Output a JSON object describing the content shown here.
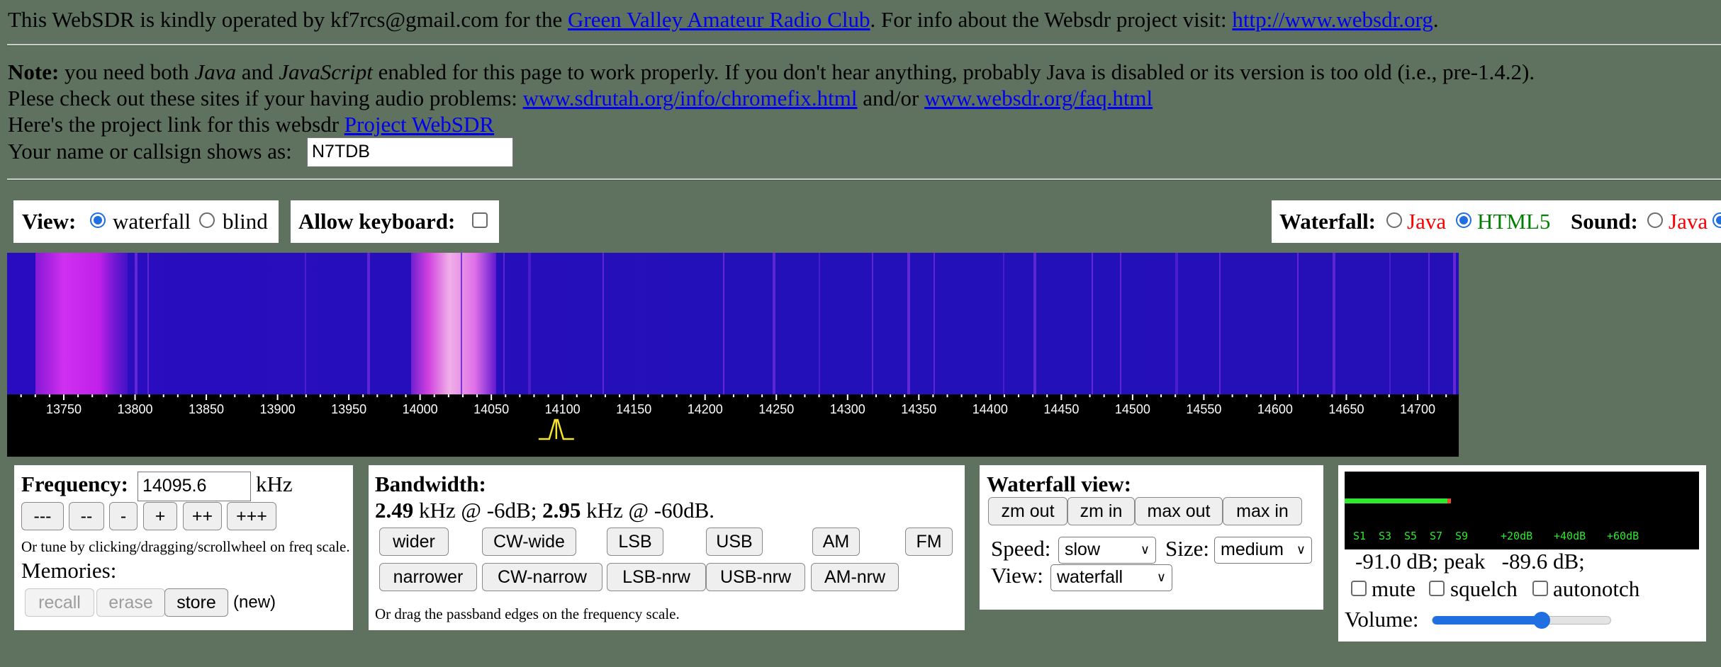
{
  "header": {
    "intro_pre": "This WebSDR is kindly operated by kf7rcs@gmail.com for the ",
    "club_link": "Green Valley Amateur Radio Club",
    "intro_mid": ". For info about the Websdr project visit: ",
    "websdr_link": "http://www.websdr.org",
    "intro_end": "."
  },
  "note": {
    "label": "Note:",
    "t1": " you need both ",
    "java": "Java",
    "t2": " and ",
    "javascript": "JavaScript",
    "t3": " enabled for this page to work properly. If you don't hear anything, probably Java is disabled or its version is too old (i.e., pre-1.4.2).",
    "check_pre": "Plese check out these sites if your having audio problems: ",
    "chromefix_link": "www.sdrutah.org/info/chromefix.html",
    "check_mid": " and/or ",
    "faq_link": "www.websdr.org/faq.html",
    "project_pre": "Here's the project link for this websdr ",
    "project_link": "Project WebSDR",
    "callsign_label": "Your name or callsign shows as:",
    "callsign_value": "N7TDB"
  },
  "view_box": {
    "label": "View:",
    "opt1": "waterfall",
    "opt2": "blind",
    "selected": "waterfall"
  },
  "keyboard_box": {
    "label": "Allow keyboard:",
    "checked": false
  },
  "engine_box": {
    "waterfall_label": "Waterfall:",
    "java": "Java",
    "html5": "HTML5",
    "sound_label": "Sound:",
    "sound_java": "Java",
    "java_color": "#ff0000",
    "html5_color": "#008000"
  },
  "scale": {
    "ticks": [
      "13750",
      "13800",
      "13850",
      "13900",
      "13950",
      "14000",
      "14050",
      "14100",
      "14150",
      "14200",
      "14250",
      "14300",
      "14350",
      "14400",
      "14450",
      "14500",
      "14550",
      "14600",
      "14650",
      "14700"
    ],
    "tuned_khz": 14095.6
  },
  "frequency_box": {
    "label": "Frequency:",
    "value": "14095.6",
    "unit": "kHz",
    "steps": [
      "---",
      "--",
      "-",
      "+",
      "++",
      "+++"
    ],
    "hint": "Or tune by clicking/dragging/scrollwheel on freq scale.",
    "memories_label": "Memories:",
    "recall": "recall",
    "erase": "erase",
    "store": "store",
    "new_label": "(new)"
  },
  "bandwidth_box": {
    "label": "Bandwidth:",
    "bw1": "2.49",
    "bw1_text": " kHz @ -6dB; ",
    "bw2": "2.95",
    "bw2_text": " kHz @ -60dB.",
    "row1": [
      "wider",
      "CW-wide",
      "LSB",
      "USB",
      "AM",
      "FM"
    ],
    "row2": [
      "narrower",
      "CW-narrow",
      "LSB-nrw",
      "USB-nrw",
      "AM-nrw"
    ],
    "hint": "Or drag the passband edges on the frequency scale."
  },
  "waterfall_view_box": {
    "label": "Waterfall view:",
    "buttons": [
      "zm out",
      "zm in",
      "max out",
      "max in"
    ],
    "speed_label": "Speed:",
    "speed_value": "slow",
    "size_label": "Size:",
    "size_value": "medium",
    "view_label": "View:",
    "view_value": "waterfall"
  },
  "audio_box": {
    "smeter_labels": [
      "S1",
      "S3",
      "S5",
      "S7",
      "S9",
      "+20dB",
      "+40dB",
      "+60dB"
    ],
    "smeter_level": 0.29,
    "level_text": "-91.0 dB; peak   -89.6 dB;",
    "mute": "mute",
    "squelch": "squelch",
    "autonotch": "autonotch",
    "volume_label": "Volume:",
    "volume_fraction": 0.62,
    "smeter_color": "#2ee82e"
  }
}
